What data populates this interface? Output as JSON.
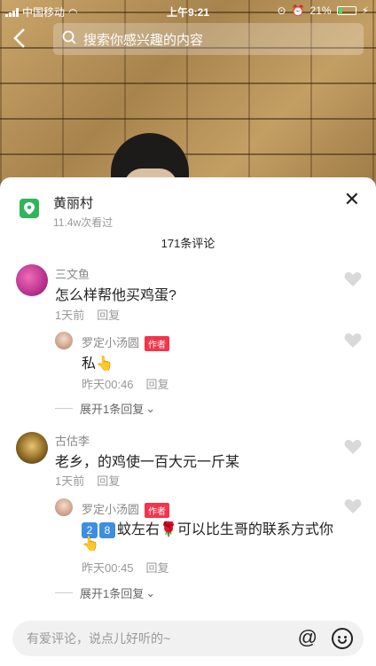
{
  "status_bar": {
    "carrier": "中国移动",
    "time": "上午9:21",
    "battery": "21%"
  },
  "search": {
    "placeholder": "搜索你感兴趣的内容"
  },
  "location": {
    "title": "黄丽村",
    "views": "11.4w次看过"
  },
  "comments_header": {
    "count": "171条评论"
  },
  "comments": [
    {
      "name": "三文鱼",
      "text": "怎么样帮他买鸡蛋?",
      "time": "1天前",
      "reply_label": "回复",
      "reply": {
        "name": "罗定小汤圆",
        "tag": "作者",
        "text": "私👆",
        "time": "昨天00:46",
        "reply_label": "回复"
      },
      "expand": "展开1条回复"
    },
    {
      "name": "古估李",
      "text": "老乡，的鸡使一百大元一斤某",
      "time": "1天前",
      "reply_label": "回复",
      "reply": {
        "name": "罗定小汤圆",
        "tag": "作者",
        "num1": "2",
        "num2": "8",
        "text": "蚊左右🌹可以比生哥的联系方式你",
        "text_line2": "👆",
        "time": "昨天00:45",
        "reply_label": "回复"
      },
      "expand": "展开1条回复"
    }
  ],
  "input": {
    "placeholder": "有爱评论，说点儿好听的~"
  },
  "colors": {
    "author_tag": "#f5344b",
    "location_icon": "#2fb55c"
  }
}
